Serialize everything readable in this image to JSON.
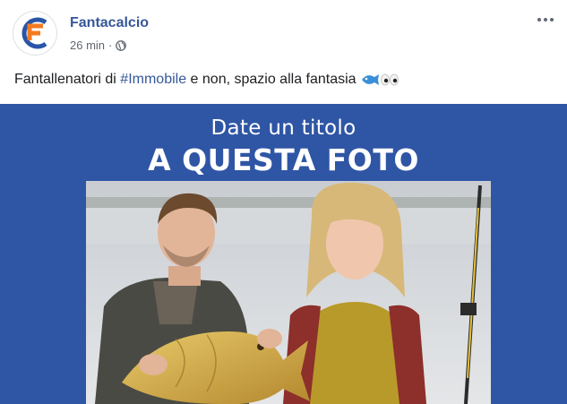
{
  "post": {
    "page_name": "Fantacalcio",
    "timestamp": "26 min",
    "separator": "·",
    "privacy_icon": "globe-icon",
    "more_icon": "more-horizontal-icon",
    "caption": {
      "text_before": "Fantallenatori di ",
      "hashtag": "#Immobile",
      "text_after": " e non, spazio alla fantasia ",
      "emojis": [
        "fish-icon",
        "eyes-icon"
      ]
    },
    "image": {
      "line1": "Date un titolo",
      "line2": "A QUESTA FOTO",
      "background": "#2f55a5"
    }
  },
  "colors": {
    "link": "#365899",
    "text": "#1c1e21",
    "meta": "#616770",
    "brand_orange": "#f47a20",
    "brand_blue": "#2a55a6"
  }
}
